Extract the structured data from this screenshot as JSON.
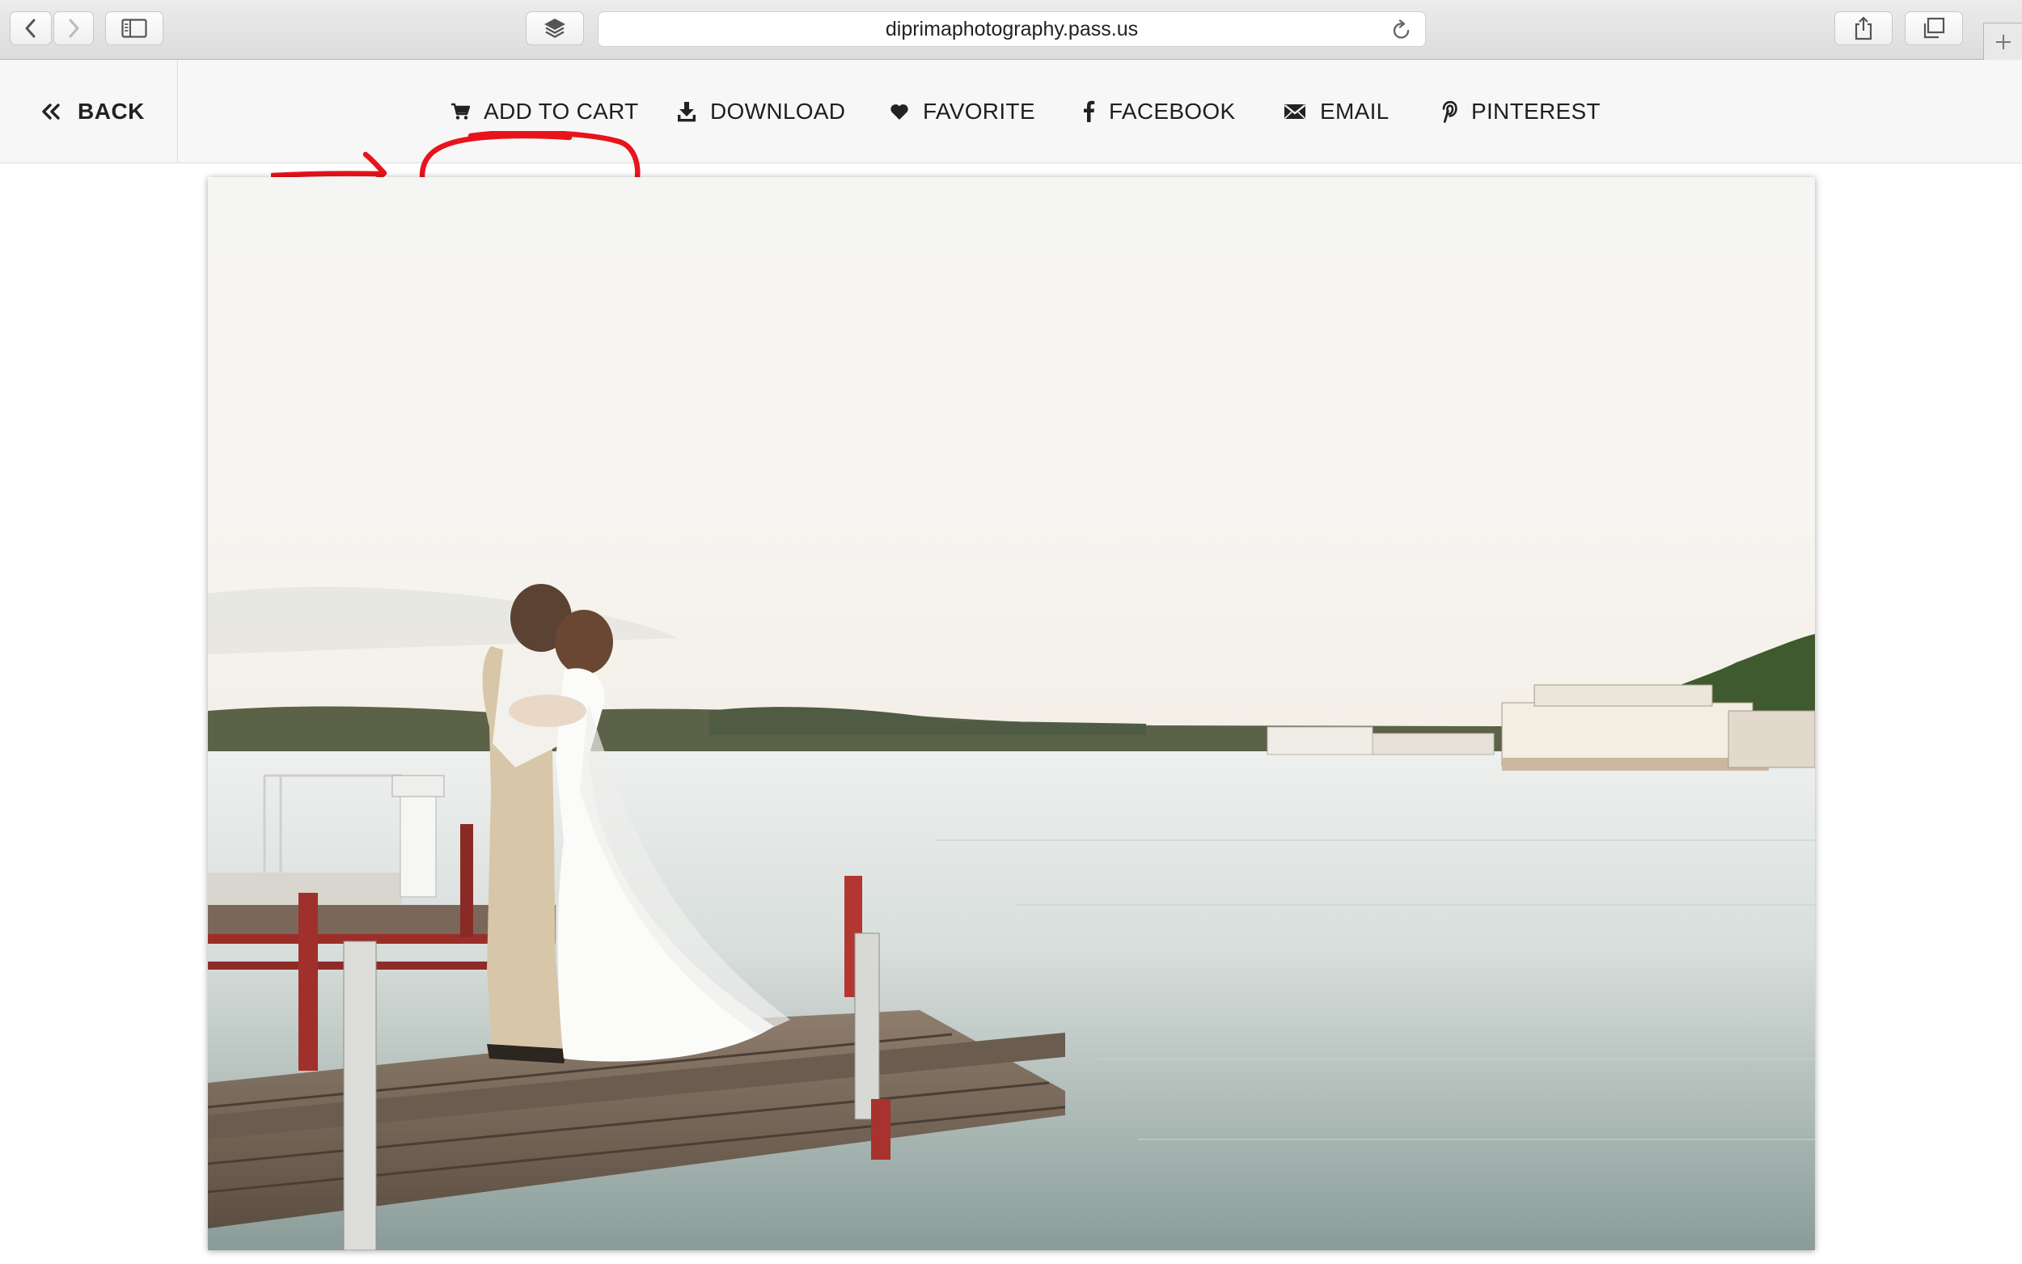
{
  "browser": {
    "url": "diprimaphotography.pass.us"
  },
  "toolbar": {
    "back_label": "BACK",
    "actions": [
      {
        "label": "ADD TO CART",
        "icon": "cart-icon"
      },
      {
        "label": "DOWNLOAD",
        "icon": "download-icon"
      },
      {
        "label": "FAVORITE",
        "icon": "heart-icon"
      },
      {
        "label": "FACEBOOK",
        "icon": "facebook-icon"
      },
      {
        "label": "EMAIL",
        "icon": "envelope-icon"
      },
      {
        "label": "PINTEREST",
        "icon": "pinterest-icon"
      }
    ],
    "highlighted_action": "ADD TO CART",
    "annotation_color": "#e8141c"
  },
  "photo": {
    "subject": "wedding couple kissing on a lake dock"
  }
}
